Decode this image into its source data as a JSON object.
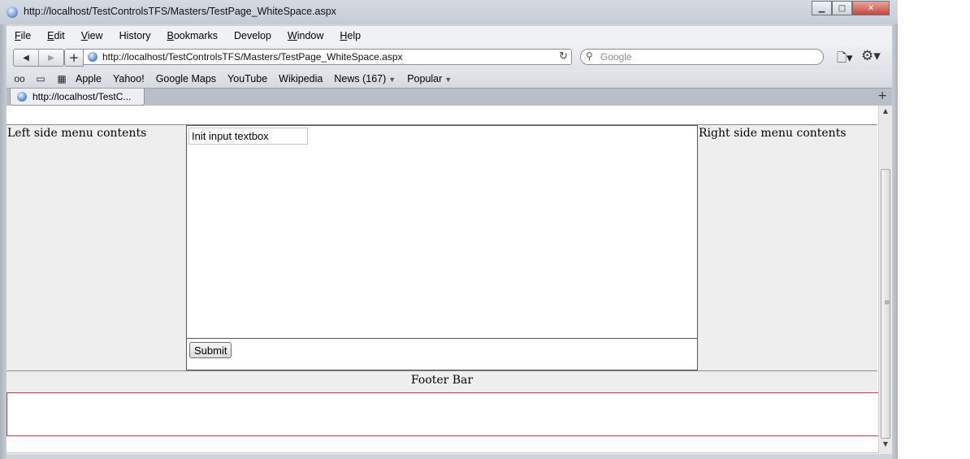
{
  "window": {
    "title": "http://localhost/TestControlsTFS/Masters/TestPage_WhiteSpace.aspx",
    "minimize_glyph": "▁",
    "maximize_glyph": "□",
    "close_glyph": "✕"
  },
  "menu": {
    "items": [
      {
        "label": "File",
        "accel": "F",
        "rest": "ile"
      },
      {
        "label": "Edit",
        "accel": "E",
        "rest": "dit"
      },
      {
        "label": "View",
        "accel": "V",
        "rest": "iew"
      },
      {
        "label": "History",
        "accel": "",
        "rest": "History"
      },
      {
        "label": "Bookmarks",
        "accel": "B",
        "rest": "ookmarks"
      },
      {
        "label": "Develop",
        "accel": "",
        "rest": "Develop"
      },
      {
        "label": "Window",
        "accel": "W",
        "rest": "indow"
      },
      {
        "label": "Help",
        "accel": "H",
        "rest": "elp"
      }
    ]
  },
  "toolbar": {
    "back_glyph": "◀",
    "forward_glyph": "▶",
    "add_glyph": "+",
    "url": "http://localhost/TestControlsTFS/Masters/TestPage_WhiteSpace.aspx",
    "reload_glyph": "↻",
    "search_placeholder": "Google",
    "search_glyph": "⚲",
    "page_glyph": "🗋▾",
    "gear_glyph": "⚙▾",
    "icons": [
      "back-icon",
      "forward-icon",
      "plus-icon",
      "globe-icon",
      "reload-icon",
      "search-icon",
      "page-menu-icon",
      "gear-icon"
    ]
  },
  "bookmarks": {
    "icon_glyphs": {
      "reading_list": "oo",
      "book": "▭",
      "grid": "▦"
    },
    "items": [
      "Apple",
      "Yahoo!",
      "Google Maps",
      "YouTube",
      "Wikipedia"
    ],
    "news": {
      "label": "News (167)",
      "caret": "▼"
    },
    "popular": {
      "label": "Popular",
      "caret": "▼"
    }
  },
  "tabs": {
    "active": {
      "label": "http://localhost/TestC..."
    },
    "new_tab_glyph": "+"
  },
  "page": {
    "left_menu": "Left side menu contents",
    "right_menu": "Right side menu contents",
    "input_value": "Init input textbox",
    "submit_label": "Submit",
    "footer": "Footer Bar"
  },
  "scrollbar": {
    "up_glyph": "▲",
    "down_glyph": "▼",
    "grip_glyph": "≡"
  },
  "colors": {
    "accent_red_border": "#c0394b",
    "pane_gray": "#eeeeee"
  }
}
